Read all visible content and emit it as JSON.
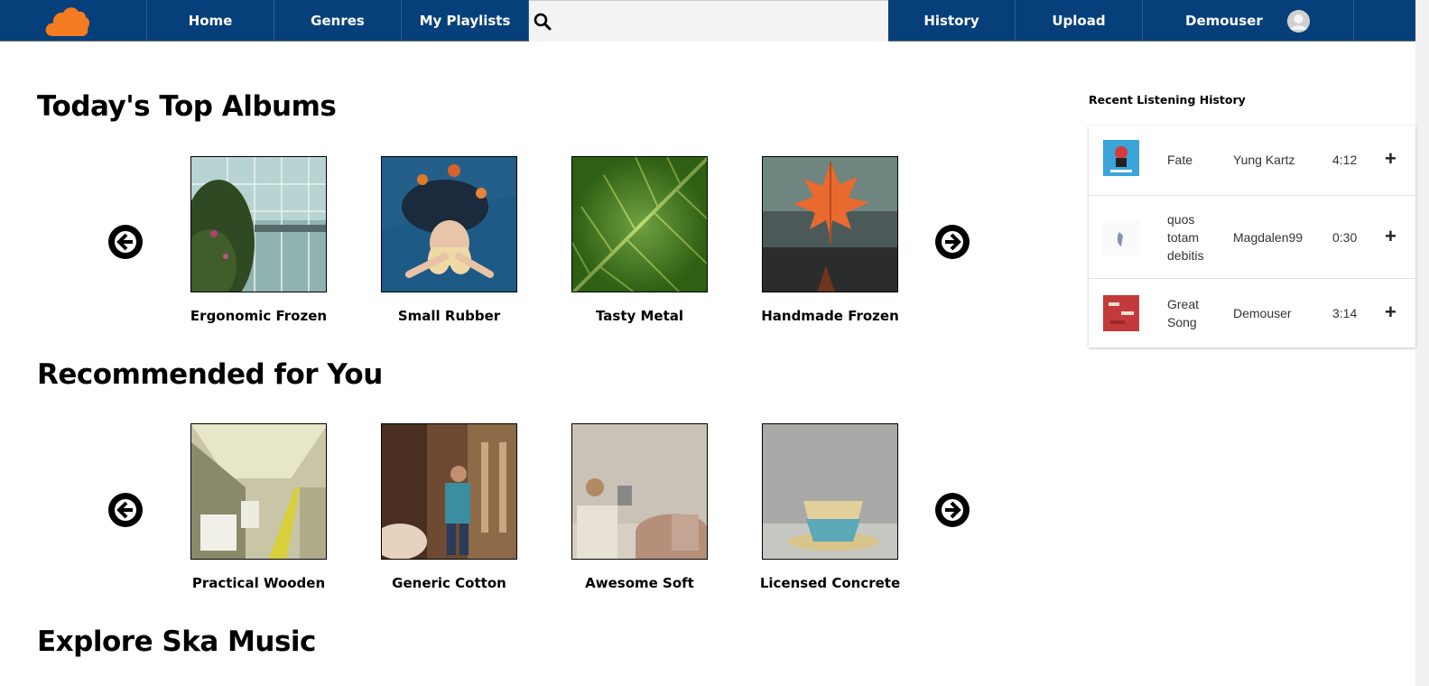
{
  "nav": {
    "home": "Home",
    "genres": "Genres",
    "playlists": "My Playlists",
    "search_placeholder": "",
    "history": "History",
    "upload": "Upload",
    "username": "Demouser",
    "brand_color": "#063f7a",
    "logo_color": "#f47b20"
  },
  "sections": [
    {
      "title": "Today's Top Albums",
      "albums": [
        "Ergonomic Frozen",
        "Small Rubber",
        "Tasty Metal",
        "Handmade Frozen"
      ]
    },
    {
      "title": "Recommended for You",
      "albums": [
        "Practical Wooden",
        "Generic Cotton",
        "Awesome Soft",
        "Licensed Concrete"
      ]
    },
    {
      "title": "Explore Ska Music"
    }
  ],
  "history": {
    "title": "Recent Listening History",
    "rows": [
      {
        "title": "Fate",
        "artist": "Yung Kartz",
        "duration": "4:12",
        "add": "+"
      },
      {
        "title": "quos totam debitis",
        "artist": "Magdalen99",
        "duration": "0:30",
        "add": "+"
      },
      {
        "title": "Great Song",
        "artist": "Demouser",
        "duration": "3:14",
        "add": "+"
      }
    ]
  }
}
